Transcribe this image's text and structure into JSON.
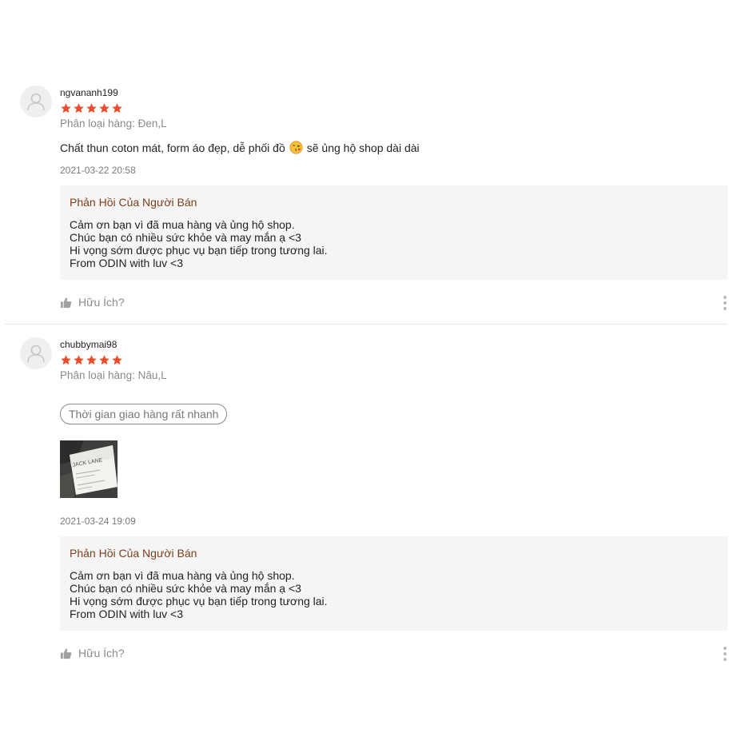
{
  "reviews": [
    {
      "username": "ngvananh199",
      "rating": 5,
      "variation": "Phân loại hàng: Đen,L",
      "comment_before_emoji": "Chất thun coton mát, form áo đẹp, dễ phối đồ",
      "emoji": "face-blowing-kiss-emoji",
      "comment_after_emoji": "sẽ ủng hộ shop dài dài",
      "time": "2021-03-22 20:58",
      "reply": {
        "title": "Phản Hồi Của Người Bán",
        "lines": [
          "Cảm ơn bạn vì đã mua hàng và ủng hộ shop.",
          "Chúc bạn có nhiều sức khỏe và may mắn ạ <3",
          "Hi vọng sớm được phục vụ bạn tiếp trong tương lai.",
          "From ODIN with luv <3"
        ]
      },
      "helpful_label": "Hữu Ích?"
    },
    {
      "username": "chubbymai98",
      "rating": 5,
      "variation": "Phân loại hàng: Nâu,L",
      "tag": "Thời gian giao hàng rất nhanh",
      "media_label": "JACK LANE",
      "time": "2021-03-24 19:09",
      "reply": {
        "title": "Phản Hồi Của Người Bán",
        "lines": [
          "Cảm ơn bạn vì đã mua hàng và ủng hộ shop.",
          "Chúc bạn có nhiều sức khỏe và may mắn ạ <3",
          "Hi vọng sớm được phục vụ bạn tiếp trong tương lai.",
          "From ODIN with luv <3"
        ]
      },
      "helpful_label": "Hữu Ích?"
    }
  ],
  "colors": {
    "star": "#ee4d2d",
    "reply_title": "#7b3f1c",
    "reply_bg": "#f5f5f5",
    "muted_text": "#8a8a8a"
  }
}
